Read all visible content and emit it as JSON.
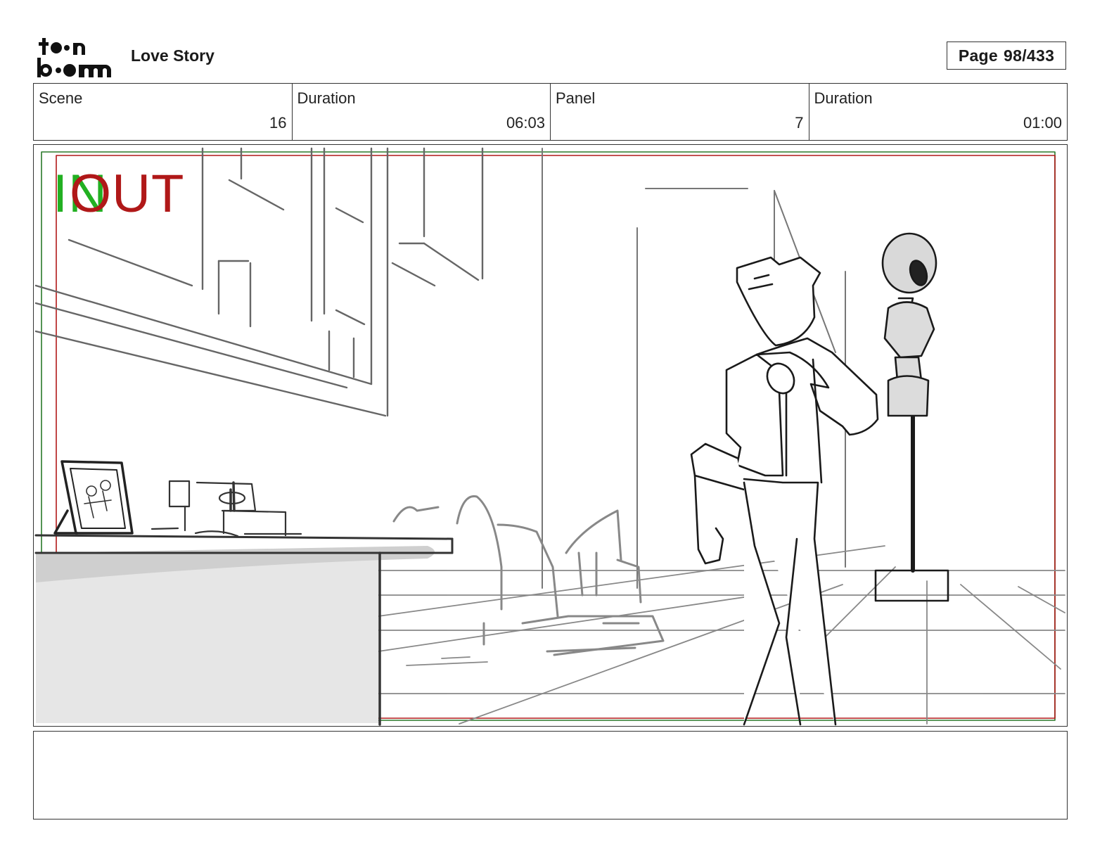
{
  "header": {
    "logo_text": "toon boom",
    "project_title": "Love Story",
    "page_label": "Page",
    "page_number": "98/433"
  },
  "info": {
    "scene_label": "Scene",
    "scene_value": "16",
    "scene_duration_label": "Duration",
    "scene_duration_value": "06:03",
    "panel_label": "Panel",
    "panel_value": "7",
    "panel_duration_label": "Duration",
    "panel_duration_value": "01:00"
  },
  "panel": {
    "in_marker": "IN",
    "out_marker": "OUT",
    "in_color": "#22b022",
    "out_color": "#b01818"
  },
  "notes": {
    "text": ""
  }
}
